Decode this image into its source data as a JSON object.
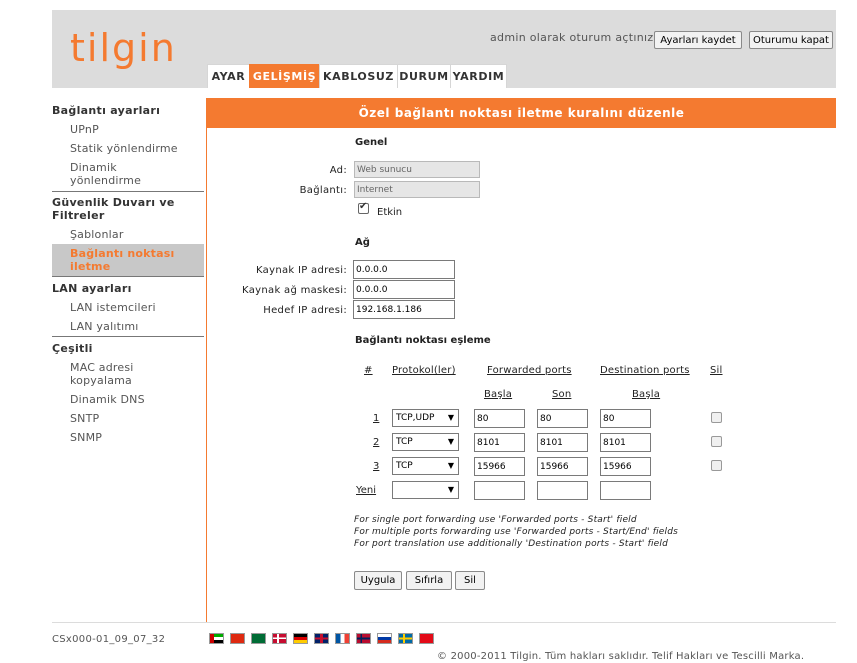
{
  "header": {
    "logo": "tilgin",
    "login_text": "admin olarak oturum açtınız.",
    "save_button": "Ayarları kaydet",
    "logout_button": "Oturumu kapat",
    "tabs": [
      "AYAR",
      "GELİŞMİŞ",
      "KABLOSUZ",
      "DURUM",
      "YARDIM"
    ],
    "active_tab": "GELİŞMİŞ"
  },
  "sidebar": {
    "sections": [
      {
        "title": "Bağlantı ayarları",
        "items": [
          "UPnP",
          "Statik yönlendirme",
          "Dinamik yönlendirme"
        ]
      },
      {
        "title": "Güvenlik Duvarı ve Filtreler",
        "items": [
          "Şablonlar",
          "Bağlantı noktası iletme"
        ]
      },
      {
        "title": "LAN ayarları",
        "items": [
          "LAN istemcileri",
          "LAN yalıtımı"
        ]
      },
      {
        "title": "Çeşitli",
        "items": [
          "MAC adresi kopyalama",
          "Dinamik DNS",
          "SNTP",
          "SNMP"
        ]
      }
    ],
    "active_item": "Bağlantı noktası iletme"
  },
  "main": {
    "title": "Özel bağlantı noktası iletme kuralını düzenle",
    "general": {
      "heading": "Genel",
      "name_label": "Ad:",
      "name_value": "Web sunucu",
      "connection_label": "Bağlantı:",
      "connection_value": "Internet",
      "enabled_label": "Etkin",
      "enabled": true
    },
    "network": {
      "heading": "Ağ",
      "src_ip_label": "Kaynak IP adresi:",
      "src_ip_value": "0.0.0.0",
      "src_mask_label": "Kaynak ağ maskesi:",
      "src_mask_value": "0.0.0.0",
      "dst_ip_label": "Hedef IP adresi:",
      "dst_ip_value": "192.168.1.186"
    },
    "mapping": {
      "heading": "Bağlantı noktası eşleme",
      "col_num": "#",
      "col_protocol": "Protokol(ler)",
      "col_forwarded": "Forwarded ports",
      "col_destination": "Destination ports",
      "col_delete": "Sil",
      "sub_start": "Başla",
      "sub_end": "Son",
      "sub_dest_start": "Başla",
      "rows": [
        {
          "num": "1",
          "protocol": "TCP,UDP",
          "fwd_start": "80",
          "fwd_end": "80",
          "dst_start": "80"
        },
        {
          "num": "2",
          "protocol": "TCP",
          "fwd_start": "8101",
          "fwd_end": "8101",
          "dst_start": "8101"
        },
        {
          "num": "3",
          "protocol": "TCP",
          "fwd_start": "15966",
          "fwd_end": "15966",
          "dst_start": "15966"
        }
      ],
      "new_row_label": "Yeni",
      "new_row": {
        "protocol": "",
        "fwd_start": "",
        "fwd_end": "",
        "dst_start": ""
      }
    },
    "notes": [
      "For single port forwarding use 'Forwarded ports - Start' field",
      "For multiple ports forwarding use 'Forwarded ports - Start/End' fields",
      "For port translation use additionally 'Destination ports - Start' field"
    ],
    "buttons": {
      "apply": "Uygula",
      "reset": "Sıfırla",
      "delete": "Sil"
    }
  },
  "footer": {
    "version": "CSx000-01_09_07_32",
    "flags": [
      "arabic-flag",
      "chinese-flag",
      "saudi-flag",
      "danish-flag",
      "german-flag",
      "uk-flag",
      "french-flag",
      "norwegian-flag",
      "russian-flag",
      "swedish-flag",
      "turkish-flag"
    ],
    "copyright": "© 2000-2011 Tilgin. Tüm hakları saklıdır. Telif Hakları ve Tescilli Marka."
  }
}
